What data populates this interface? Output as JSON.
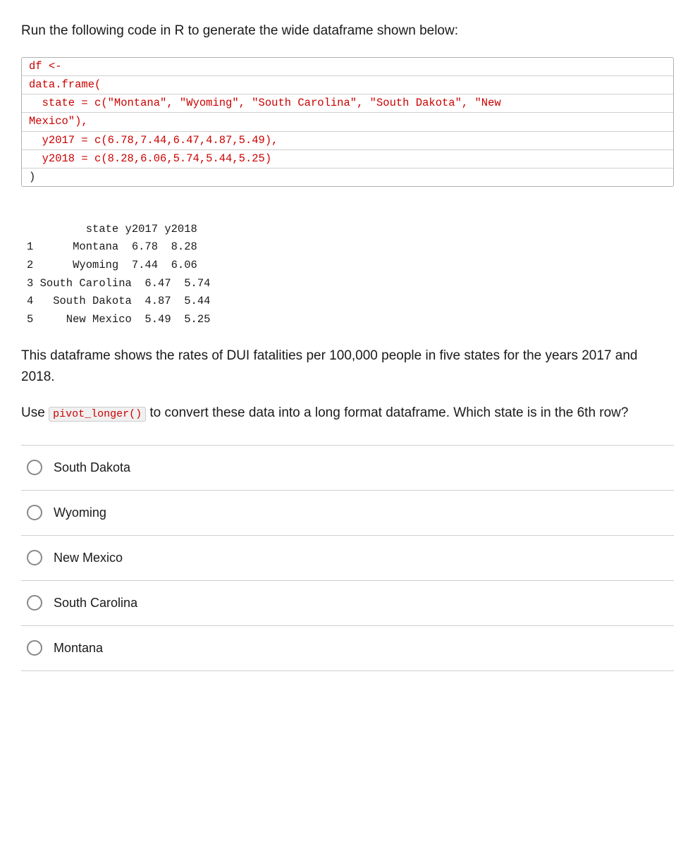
{
  "intro": {
    "text": "Run the following code in R to generate the wide dataframe shown below:"
  },
  "code": {
    "lines": [
      {
        "id": "line1",
        "content": "df <-",
        "color": "red"
      },
      {
        "id": "line2",
        "content": "data.frame(",
        "color": "red"
      },
      {
        "id": "line3",
        "content": "  state = c(\"Montana\", \"Wyoming\", \"South Carolina\", \"South Dakota\", \"New",
        "color": "red"
      },
      {
        "id": "line4",
        "content": "Mexico\"),",
        "color": "red"
      },
      {
        "id": "line5",
        "content": "  y2017 = c(6.78,7.44,6.47,4.87,5.49),",
        "color": "red"
      },
      {
        "id": "line6",
        "content": "  y2018 = c(8.28,6.06,5.74,5.44,5.25)",
        "color": "red"
      },
      {
        "id": "line7",
        "content": ")",
        "color": "black"
      }
    ]
  },
  "dataframe": {
    "header": "          state y2017 y2018",
    "rows": [
      "1       Montana  6.78  8.28",
      "2       Wyoming  7.44  6.06",
      "3 South Carolina  6.47  5.74",
      "4   South Dakota  4.87  5.44",
      "5     New Mexico  5.49  5.25"
    ]
  },
  "description": {
    "text": "This dataframe shows the rates of DUI fatalities per 100,000 people in five states for the years 2017 and 2018."
  },
  "question": {
    "prefix": "Use",
    "inline_code": "pivot_longer()",
    "suffix": "to convert these data into a long format dataframe. Which state is in the 6th row?"
  },
  "answers": [
    {
      "id": "option-south-dakota",
      "label": "South Dakota"
    },
    {
      "id": "option-wyoming",
      "label": "Wyoming"
    },
    {
      "id": "option-new-mexico",
      "label": "New Mexico"
    },
    {
      "id": "option-south-carolina",
      "label": "South Carolina"
    },
    {
      "id": "option-montana",
      "label": "Montana"
    }
  ]
}
